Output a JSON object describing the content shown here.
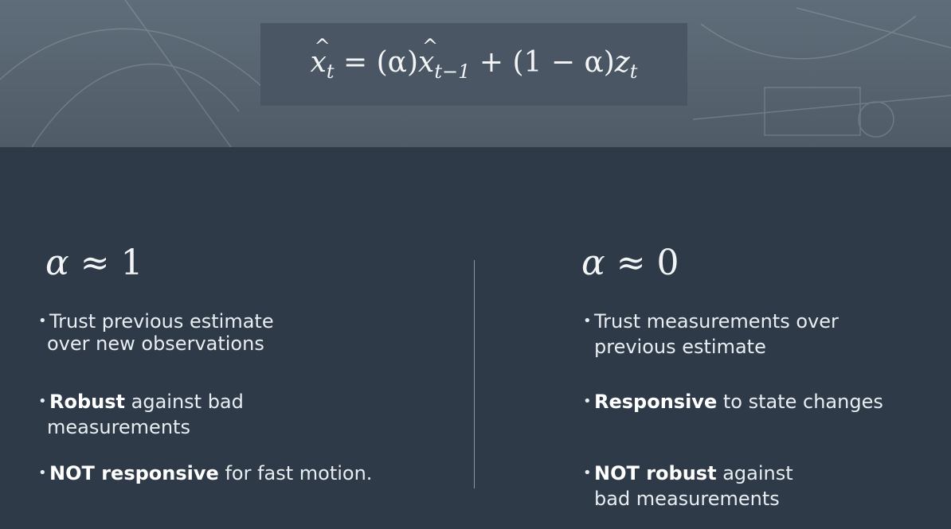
{
  "header": {
    "formula": {
      "lhs_var": "x",
      "lhs_sub": "t",
      "equals": "=",
      "alpha_term": "(α)",
      "rhs_var": "x",
      "rhs_sub": "t−1",
      "plus": "+",
      "one_minus": "(1 − α)",
      "z_var": "z",
      "z_sub": "t"
    }
  },
  "left": {
    "heading_var": "α",
    "heading_rest": " ≈ 1",
    "bullet_char": "•",
    "bullets": [
      {
        "bold": "",
        "text": "Trust previous estimate",
        "line2": "over new observations"
      },
      {
        "bold": "Robust",
        "text": " against bad",
        "line2": "measurements"
      },
      {
        "bold": "NOT responsive",
        "text": " for fast motion.",
        "line2": ""
      }
    ]
  },
  "right": {
    "heading_var": "α",
    "heading_rest": " ≈ 0",
    "bullet_char": "•",
    "bullets": [
      {
        "bold": "",
        "text": "Trust measurements over",
        "line2": "previous estimate"
      },
      {
        "bold": "Responsive",
        "text": " to state changes",
        "line2": ""
      },
      {
        "bold": "NOT robust",
        "text": " against",
        "line2": "bad measurements"
      }
    ]
  },
  "colors": {
    "background": "#2e3a48",
    "band": "#56636f",
    "formula_box": "#4a5663",
    "divider": "#8a96a3"
  }
}
